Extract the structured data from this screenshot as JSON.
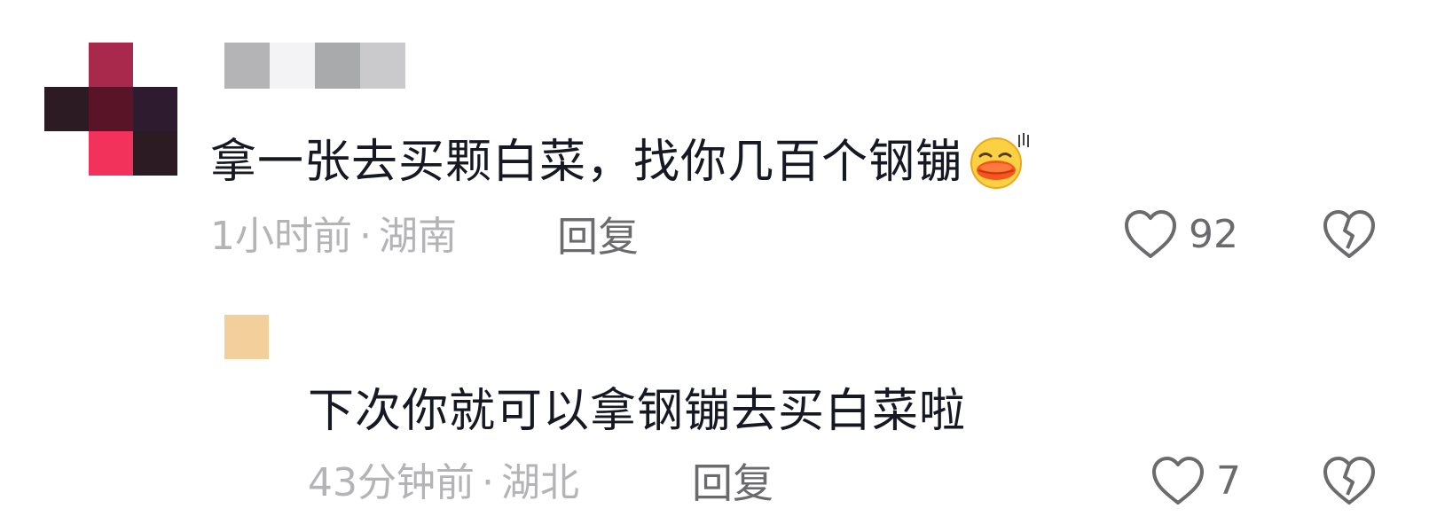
{
  "comment": {
    "text": "拿一张去买颗白菜，找你几百个钢镚",
    "emoji": "duck-lips-emoji",
    "time": "1小时前",
    "separator": "·",
    "location": "湖南",
    "reply_label": "回复",
    "like_count": "92",
    "avatar_colors": [
      "#a8294c",
      "#2c1b22",
      "#5a1428",
      "#2f1b2f",
      "#f2325b"
    ],
    "username_colors": [
      "#b4b4b6",
      "#f3f3f5",
      "#a9aaac",
      "#cacacc"
    ]
  },
  "reply": {
    "text": "下次你就可以拿钢镚去买白菜啦",
    "time": "43分钟前",
    "separator": "·",
    "location": "湖北",
    "reply_label": "回复",
    "like_count": "7",
    "avatar_color": "#f2cf9b"
  },
  "colors": {
    "text": "#161823",
    "meta": "#b4b4b7",
    "action": "#6b6b6e"
  }
}
